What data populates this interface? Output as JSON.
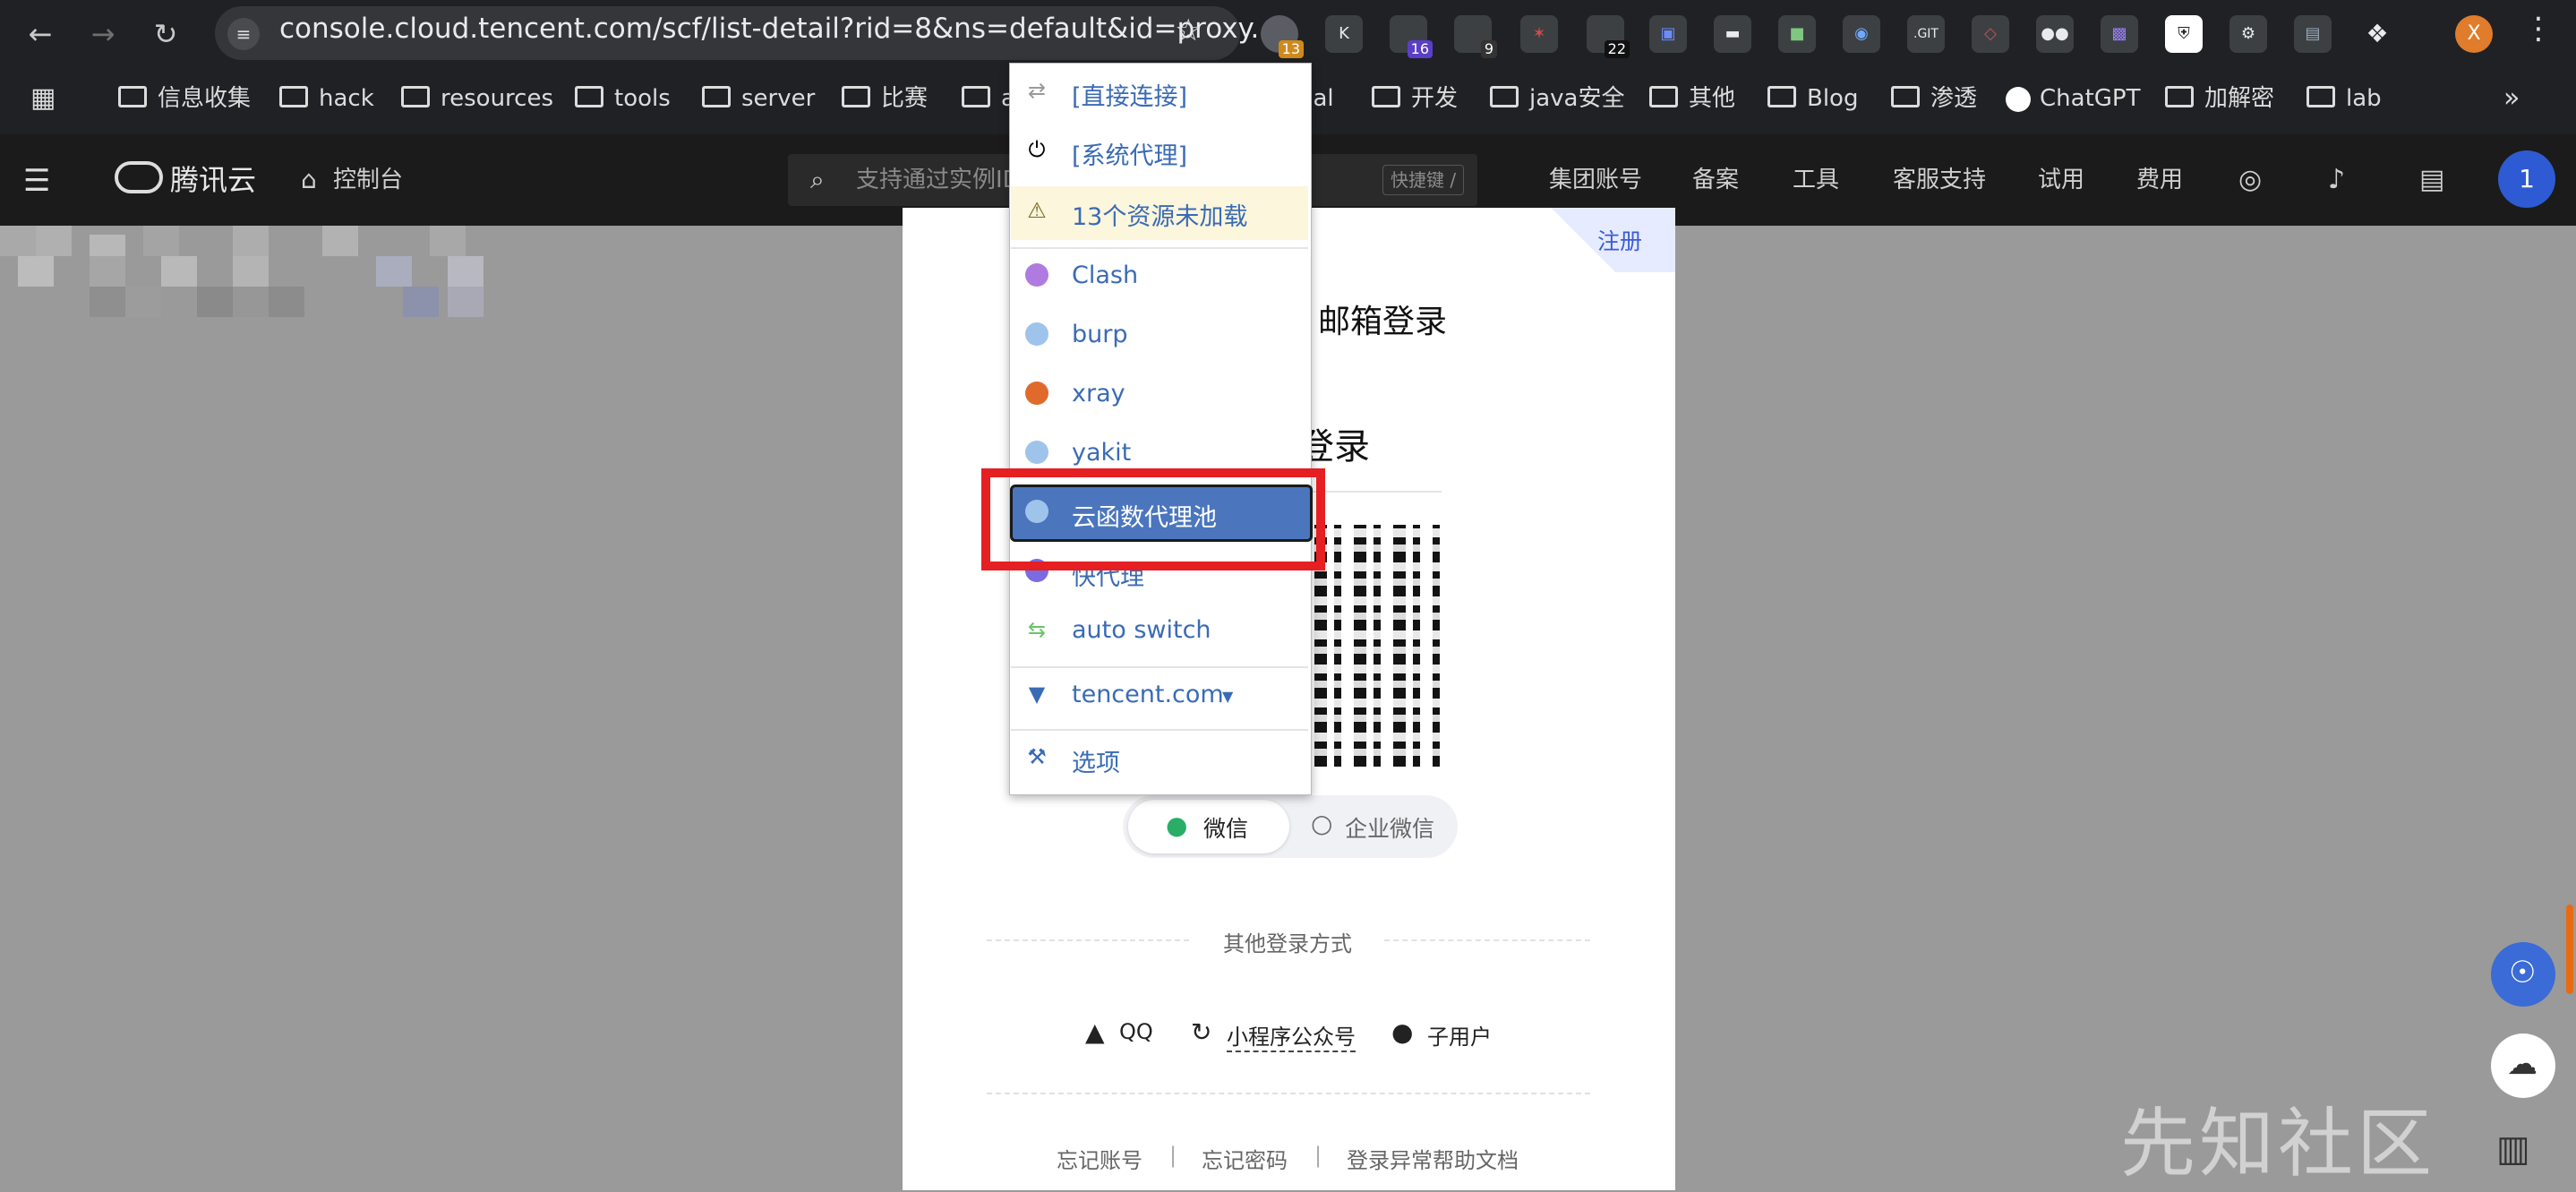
{
  "browser": {
    "url": "console.cloud.tencent.com/scf/list-detail?rid=8&ns=default&id=proxy...",
    "profile_initial": "X",
    "extensions": [
      {
        "name": "switchyomega-icon",
        "badge": "13"
      },
      {
        "name": "k-icon",
        "badge": ""
      },
      {
        "name": "ext-purple-icon",
        "badge": "16"
      },
      {
        "name": "ext-qr-icon",
        "badge": "9"
      },
      {
        "name": "ext-red-icon",
        "badge": ""
      },
      {
        "name": "ext-22-icon",
        "badge": "22"
      },
      {
        "name": "ext-blue-icon",
        "badge": ""
      },
      {
        "name": "ext-hat-icon",
        "badge": ""
      },
      {
        "name": "ext-green-icon",
        "badge": ""
      },
      {
        "name": "ext-eye-icon",
        "badge": ""
      },
      {
        "name": "ext-git-icon",
        "badge": ".GIT"
      },
      {
        "name": "ext-diamond-icon",
        "badge": ""
      },
      {
        "name": "ext-owl-icon",
        "badge": ""
      },
      {
        "name": "ext-image-icon",
        "badge": ""
      },
      {
        "name": "ext-shield-icon",
        "badge": ""
      },
      {
        "name": "ext-gear-icon",
        "badge": ""
      },
      {
        "name": "ext-save-icon",
        "badge": ""
      },
      {
        "name": "extensions-puzzle-icon",
        "badge": ""
      }
    ],
    "bookmarks": [
      "信息收集",
      "hack",
      "resources",
      "tools",
      "server",
      "比赛",
      "a",
      "ual",
      "开发",
      "java安全",
      "其他",
      "Blog",
      "渗透",
      "ChatGPT",
      "加解密",
      "lab"
    ],
    "more": "»"
  },
  "header": {
    "logo_text": "腾讯云",
    "console": "控制台",
    "search_placeholder": "支持通过实例ID",
    "shortcut": "快捷键 /",
    "nav": [
      "集团账号",
      "备案",
      "工具",
      "客服支持",
      "试用",
      "费用"
    ],
    "avatar": "1"
  },
  "login": {
    "register": "注册",
    "email_login": "邮箱登录",
    "title_partial": "登录",
    "tab_wechat": "微信",
    "tab_wecom": "企业微信",
    "other_methods": "其他登录方式",
    "methods": [
      "QQ",
      "小程序公众号",
      "子用户"
    ],
    "footer": [
      "忘记账号",
      "|",
      "忘记密码",
      "|",
      "登录异常帮助文档"
    ]
  },
  "proxy_menu": {
    "items": [
      {
        "label": "[直接连接]",
        "icon": "direct-arrows-icon"
      },
      {
        "label": "[系统代理]",
        "icon": "power-icon"
      },
      {
        "label": "13个资源未加载",
        "icon": "warning-icon"
      },
      {
        "label": "Clash",
        "icon": "globe-icon",
        "color": "#b07be0"
      },
      {
        "label": "burp",
        "icon": "globe-icon",
        "color": "#9fc4ec"
      },
      {
        "label": "xray",
        "icon": "globe-icon",
        "color": "#e06a2c"
      },
      {
        "label": "yakit",
        "icon": "globe-icon",
        "color": "#9fc4ec"
      },
      {
        "label": "云函数代理池",
        "icon": "globe-icon",
        "color": "#9fc4ec"
      },
      {
        "label": "快代理",
        "icon": "globe-icon",
        "color": "#7a6be0"
      },
      {
        "label": "auto switch",
        "icon": "auto-switch-icon"
      },
      {
        "label": "tencent.com",
        "icon": "filter-icon"
      },
      {
        "label": "选项",
        "icon": "wrench-icon"
      }
    ],
    "selected_index": 7,
    "highlight_color": "#e51f22"
  },
  "watermark": "先知社区"
}
